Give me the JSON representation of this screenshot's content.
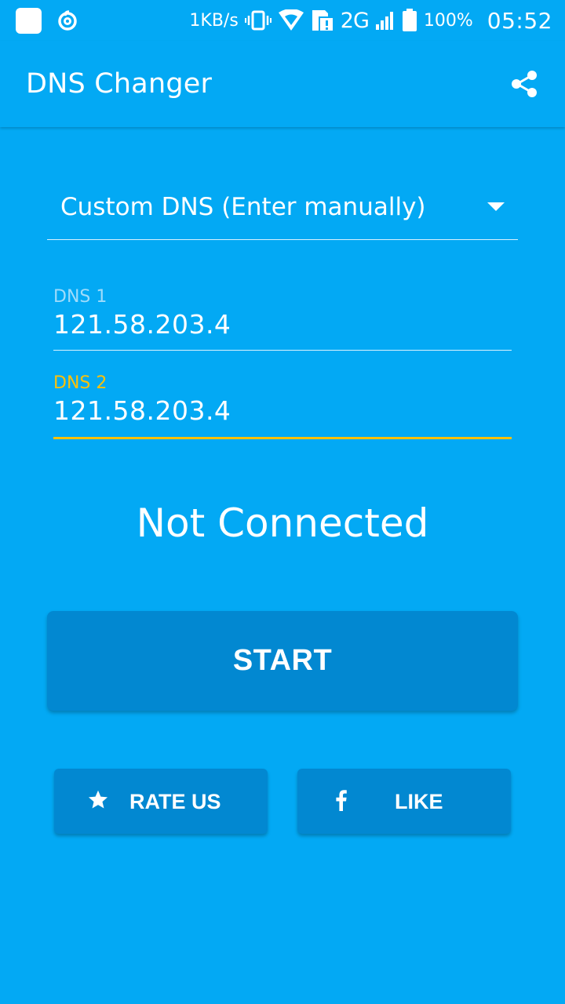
{
  "status_bar": {
    "net_speed": "1KB/s",
    "network": "2G",
    "battery": "100%",
    "time": "05:52"
  },
  "toolbar": {
    "title": "DNS Changer",
    "share_icon": "share-icon"
  },
  "dns_selector": {
    "selected": "Custom DNS (Enter manually)"
  },
  "dns1": {
    "label": "DNS 1",
    "value": "121.58.203.4"
  },
  "dns2": {
    "label": "DNS 2",
    "value": "121.58.203.4"
  },
  "connection_status": "Not Connected",
  "start_button": "START",
  "rate_button": {
    "label": "RATE US",
    "icon": "star-icon"
  },
  "like_button": {
    "label": "LIKE",
    "icon": "facebook-icon"
  },
  "colors": {
    "background": "#03A9F4",
    "button": "#0288D1",
    "accent": "#FFC107"
  }
}
